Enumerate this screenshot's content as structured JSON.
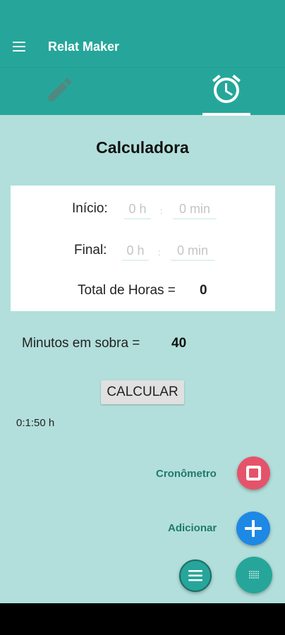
{
  "app": {
    "title": "Relat Maker"
  },
  "tabs": [
    {
      "icon": "pencil-icon",
      "selected": false
    },
    {
      "icon": "alarm-clock-icon",
      "selected": true
    }
  ],
  "calculator": {
    "title": "Calculadora",
    "inicio": {
      "label": "Início:",
      "hours_placeholder": "0 h",
      "minutes_placeholder": "0 min",
      "separator": ":"
    },
    "final": {
      "label": "Final:",
      "hours_placeholder": "0 h",
      "minutes_placeholder": "0 min",
      "separator": ":"
    },
    "total": {
      "label": "Total de Horas =",
      "value": "0"
    }
  },
  "sobra": {
    "label": "Minutos em sobra =",
    "value": "40"
  },
  "calc_button": {
    "label": "CALCULAR"
  },
  "timer": {
    "value": "0:1:50 h"
  },
  "fabs": {
    "cronometro_label": "Cronômetro",
    "adicionar_label": "Adicionar"
  },
  "colors": {
    "primary": "#26a69a",
    "background": "#b2dfdb",
    "stop": "#e5536a",
    "add": "#1e88e5"
  }
}
